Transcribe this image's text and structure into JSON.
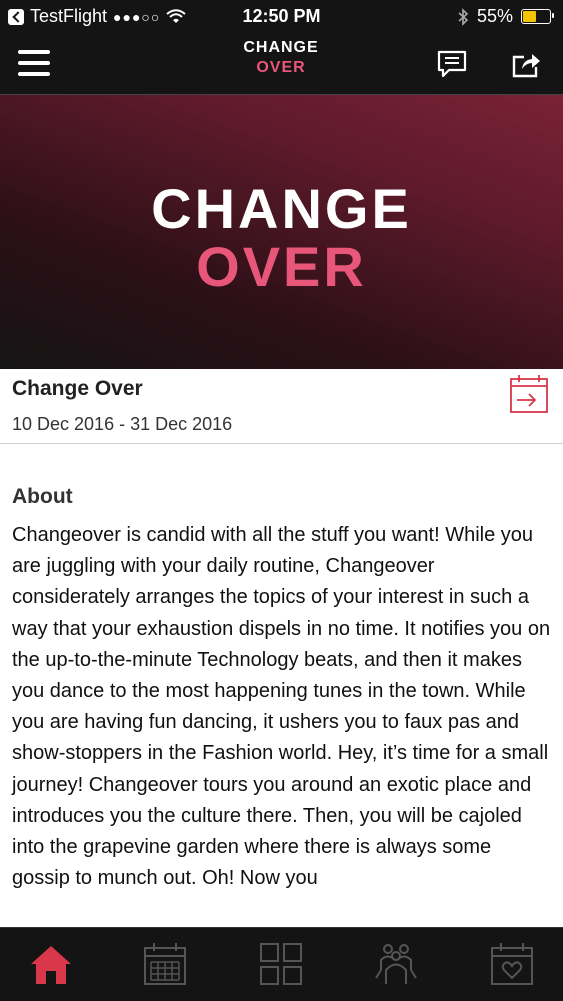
{
  "status_bar": {
    "back_app": "TestFlight",
    "signal": "●●●○○",
    "time": "12:50 PM",
    "battery": "55%",
    "battery_level": 0.55
  },
  "nav": {
    "logo_line1": "CHANGE",
    "logo_line2": "OVER",
    "icons": [
      "menu-icon",
      "chat-icon",
      "share-icon"
    ]
  },
  "banner": {
    "logo_line1": "CHANGE",
    "logo_line2": "OVER"
  },
  "event": {
    "title": "Change Over",
    "dates": "10 Dec 2016 - 31 Dec 2016",
    "icon": "calendar-add-icon"
  },
  "about": {
    "heading": "About",
    "text": "Changeover is candid with all the stuff you want! While you are juggling with your daily routine, Changeover considerately arranges the topics of your interest in such a way that your exhaustion dispels in no time. It notifies you on the up-to-the-minute Technology beats, and then it makes you dance to the most happening tunes in the town. While you are having fun dancing, it ushers you to faux pas and show-stoppers in the Fashion world. Hey, it’s time for a small journey! Changeover tours you around an exotic place and introduces you the culture there. Then, you will be cajoled into the grapevine garden where there is always some gossip to munch out. Oh! Now you"
  },
  "tabbar": {
    "tabs": [
      "home-icon",
      "calendar-icon",
      "grid-icon",
      "people-icon",
      "favorite-calendar-icon"
    ],
    "active_color": "#d9374a",
    "inactive_color": "#555555"
  }
}
